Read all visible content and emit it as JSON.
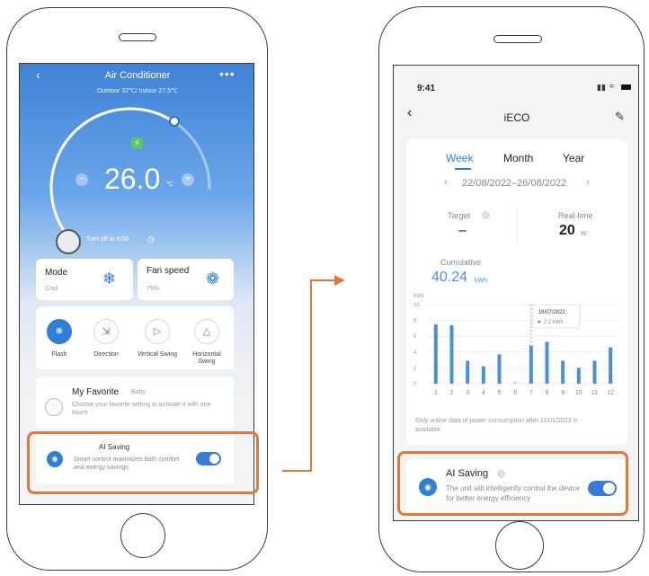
{
  "left_phone": {
    "header": {
      "title": "Air Conditioner",
      "subtitle": "Outdoor 32℃/ Indoor 27.5℃",
      "back_icon": "chevron-left-icon",
      "more_icon": "more-icon"
    },
    "thermostat": {
      "temperature": "26.0",
      "unit": "℃",
      "minus": "−",
      "plus": "+",
      "eco_icon": "leaf-icon"
    },
    "timer": {
      "text": "Turn off at 6:00"
    },
    "mode_card": {
      "label": "Mode",
      "value": "Cool",
      "icon": "snowflake-icon"
    },
    "fan_card": {
      "label": "Fan speed",
      "value": "75%",
      "icon": "fan-icon"
    },
    "controls": [
      {
        "label": "Flash",
        "icon": "flash-icon",
        "active": true
      },
      {
        "label": "Direction",
        "icon": "direction-icon",
        "active": false
      },
      {
        "label": "Vertical Swing",
        "icon": "vertical-swing-icon",
        "active": false
      },
      {
        "label": "Horizontal Swing",
        "icon": "horizontal-swing-icon",
        "active": false
      }
    ],
    "favorite": {
      "title": "My Favorite",
      "tag": "Baby",
      "desc": "Choose your favorite setting to activate it with one touch"
    },
    "ai_saving": {
      "title": "AI Saving",
      "desc": "Smart control maximizes both comfort and energy savings",
      "enabled": true
    }
  },
  "right_phone": {
    "status_bar": {
      "time": "9:41"
    },
    "header": {
      "title": "iECO"
    },
    "tabs": [
      "Week",
      "Month",
      "Year"
    ],
    "active_tab": "Week",
    "date_range": "22/08/2022–26/08/2022",
    "target": {
      "label": "Target",
      "value": "–"
    },
    "realtime": {
      "label": "Real-time",
      "value": "20",
      "unit": "W"
    },
    "cumulative": {
      "label": "Cumulative",
      "value": "40.24",
      "unit": "kWh"
    },
    "tooltip": {
      "date": "16/07/2022",
      "value": "2.2 kWh"
    },
    "note": "Only online data of power consumption after 11/01/2023 is available.",
    "ai_saving": {
      "title": "AI Saving",
      "desc": "The unit will intelligently control the device for better energy efficiency",
      "enabled": true
    }
  },
  "chart_data": {
    "type": "bar",
    "ylabel": "kWh",
    "ylim": [
      0,
      10
    ],
    "yticks": [
      "0",
      "2",
      "4",
      "6",
      "8",
      "10"
    ],
    "categories": [
      "1",
      "2",
      "3",
      "4",
      "5",
      "6",
      "7",
      "8",
      "9",
      "10",
      "11",
      "12"
    ],
    "values": [
      7.5,
      7.4,
      2.9,
      2.2,
      3.7,
      0.3,
      4.8,
      5.3,
      2.9,
      2.0,
      2.9,
      4.6
    ],
    "grid": true,
    "color": "#4a90d9"
  },
  "colors": {
    "accent": "#2f7fd4",
    "highlight": "#e07a3a",
    "toggle": "#3a7ad6"
  }
}
